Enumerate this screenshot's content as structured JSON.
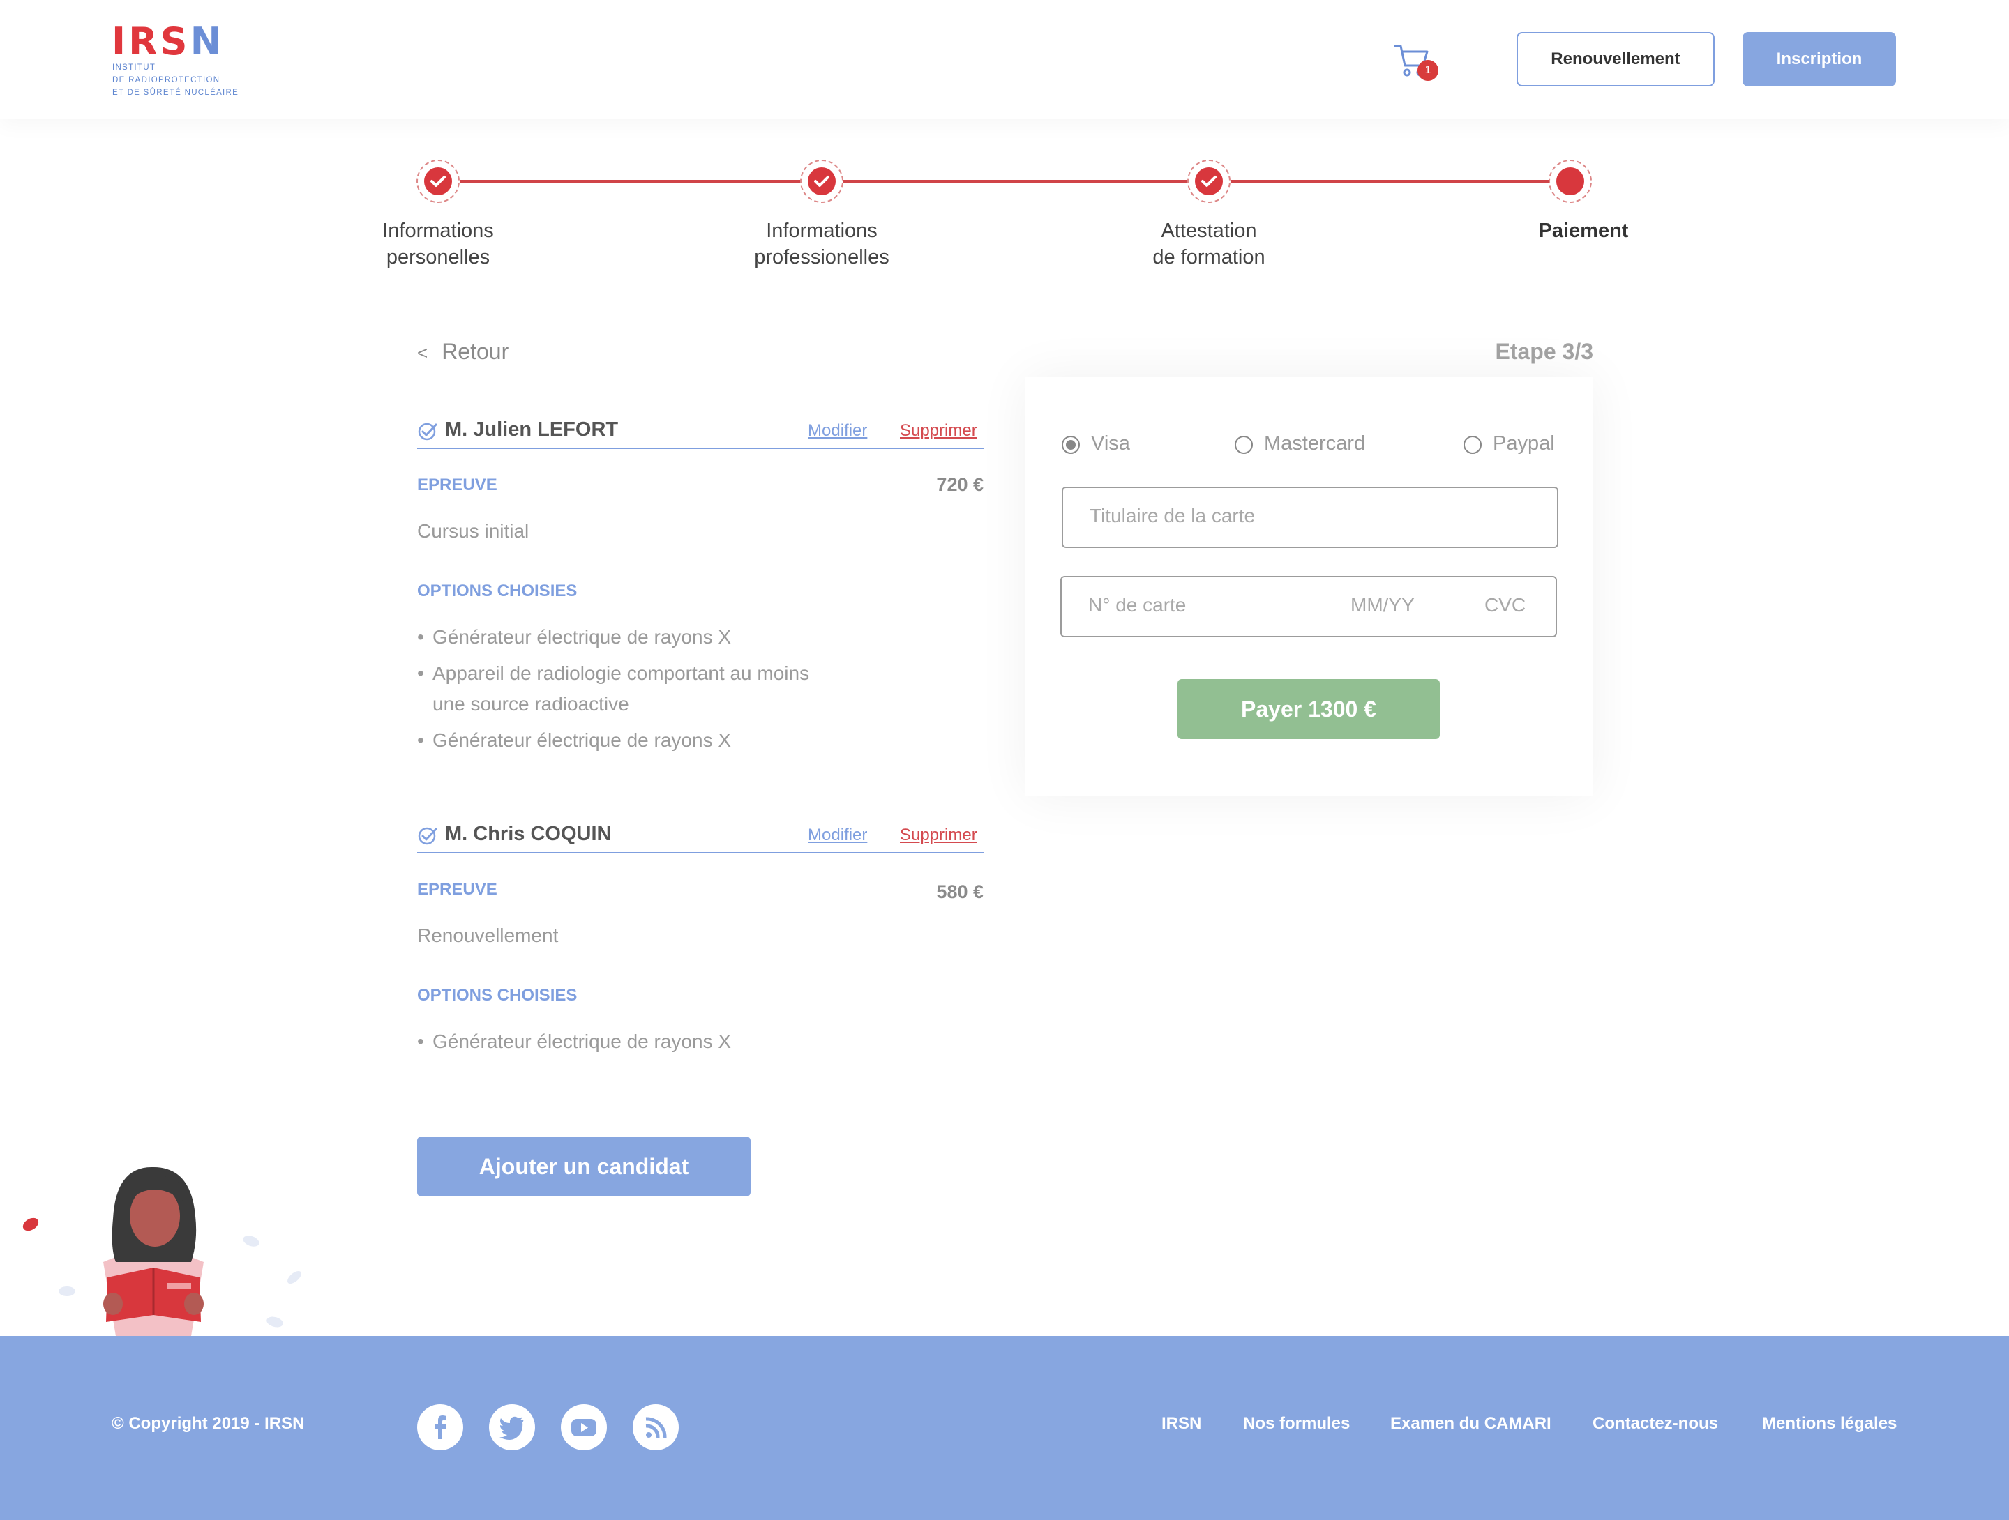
{
  "header": {
    "logo_text": "IRSN",
    "logo_subtitle": [
      "INSTITUT",
      "DE RADIOPROTECTION",
      "ET DE SÛRETÉ NUCLÉAIRE"
    ],
    "cart_count": "1",
    "renew_label": "Renouvellement",
    "signup_label": "Inscription"
  },
  "stepper": {
    "steps": [
      {
        "line1": "Informations",
        "line2": "personelles",
        "status": "done"
      },
      {
        "line1": "Informations",
        "line2": "professionelles",
        "status": "done"
      },
      {
        "line1": "Attestation",
        "line2": "de formation",
        "status": "done"
      },
      {
        "line1": "Paiement",
        "line2": "",
        "status": "current"
      }
    ]
  },
  "nav": {
    "back_chevron": "<",
    "back_label": "Retour",
    "step_counter": "Etape 3/3"
  },
  "candidates": [
    {
      "name": "M. Julien LEFORT",
      "modify_label": "Modifier",
      "delete_label": "Supprimer",
      "exam_label": "EPREUVE",
      "price": "720 €",
      "exam_type": "Cursus initial",
      "options_label": "OPTIONS CHOISIES",
      "options": [
        {
          "text": "Générateur électrique de rayons X"
        },
        {
          "text": "Appareil de radiologie comportant au moins",
          "cont": "une source radioactive"
        },
        {
          "text": "Générateur électrique de rayons X"
        }
      ]
    },
    {
      "name": "M. Chris COQUIN",
      "modify_label": "Modifier",
      "delete_label": "Supprimer",
      "exam_label": "EPREUVE",
      "price": "580 €",
      "exam_type": "Renouvellement",
      "options_label": "OPTIONS CHOISIES",
      "options": [
        {
          "text": "Générateur électrique de rayons X"
        }
      ]
    }
  ],
  "add_candidate_label": "Ajouter un candidat",
  "payment": {
    "methods": [
      {
        "label": "Visa",
        "selected": true
      },
      {
        "label": "Mastercard",
        "selected": false
      },
      {
        "label": "Paypal",
        "selected": false
      }
    ],
    "holder_placeholder": "Titulaire de la carte",
    "card_number_placeholder": "N° de carte",
    "expiry_placeholder": "MM/YY",
    "cvc_placeholder": "CVC",
    "pay_label": "Payer 1300 €"
  },
  "footer": {
    "copyright": "© Copyright 2019 - IRSN",
    "social": [
      "facebook-icon",
      "twitter-icon",
      "youtube-icon",
      "rss-icon"
    ],
    "links": [
      "IRSN",
      "Nos formules",
      "Examen du CAMARI",
      "Contactez-nous",
      "Mentions légales"
    ]
  },
  "colors": {
    "brand_red": "#d8373d",
    "brand_blue": "#87a6e0",
    "pay_green": "#92bf92"
  }
}
